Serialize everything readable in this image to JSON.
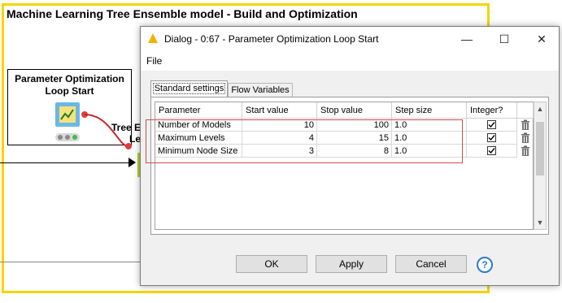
{
  "canvas": {
    "annotation_title": "Machine Learning Tree Ensemble model - Build and Optimization",
    "node": {
      "title_line1": "Parameter Optimization",
      "title_line2": "Loop Start"
    },
    "partial_node": {
      "line1": "Tree E",
      "line2": "Le"
    },
    "annotation_color": "#f5d400"
  },
  "dialog": {
    "title": "Dialog - 0:67 - Parameter Optimization Loop Start",
    "window_buttons": {
      "minimize": "—",
      "maximize": "☐",
      "close": "✕"
    },
    "menu": {
      "file": "File"
    },
    "tabs": [
      {
        "label": "Standard settings",
        "active": true
      },
      {
        "label": "Flow Variables",
        "active": false
      }
    ],
    "table": {
      "columns": [
        "Parameter",
        "Start value",
        "Stop value",
        "Step size",
        "Integer?"
      ],
      "rows": [
        {
          "parameter": "Number of Models",
          "start": "10",
          "stop": "100",
          "step": "1.0",
          "integer": true
        },
        {
          "parameter": "Maximum Levels",
          "start": "4",
          "stop": "15",
          "step": "1.0",
          "integer": true
        },
        {
          "parameter": "Minimum Node Size",
          "start": "3",
          "stop": "8",
          "step": "1.0",
          "integer": true
        }
      ]
    },
    "buttons": {
      "ok": "OK",
      "apply": "Apply",
      "cancel": "Cancel",
      "help": "?"
    },
    "highlight_color": "#d24b4b",
    "title_icon": "warning-triangle-icon"
  }
}
